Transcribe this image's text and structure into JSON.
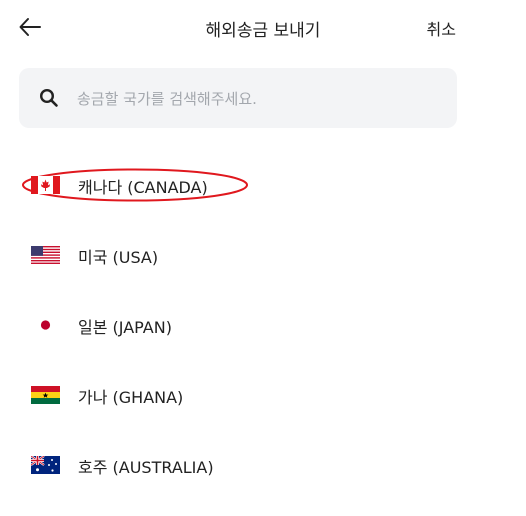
{
  "header": {
    "back_icon": "arrow-left-icon",
    "title": "해외송금 보내기",
    "cancel_label": "취소"
  },
  "search": {
    "icon": "search-icon",
    "placeholder": "송금할 국가를 검색해주세요."
  },
  "countries": [
    {
      "label": "캐나다 (CANADA)",
      "flag": "canada-flag-icon",
      "highlighted": true
    },
    {
      "label": "미국 (USA)",
      "flag": "usa-flag-icon"
    },
    {
      "label": "일본 (JAPAN)",
      "flag": "japan-flag-icon"
    },
    {
      "label": "가나 (GHANA)",
      "flag": "ghana-flag-icon"
    },
    {
      "label": "호주 (AUSTRALIA)",
      "flag": "australia-flag-icon"
    }
  ],
  "colors": {
    "highlight": "#e0181e",
    "search_bg": "#f3f4f6",
    "placeholder": "#a3a7ad"
  }
}
